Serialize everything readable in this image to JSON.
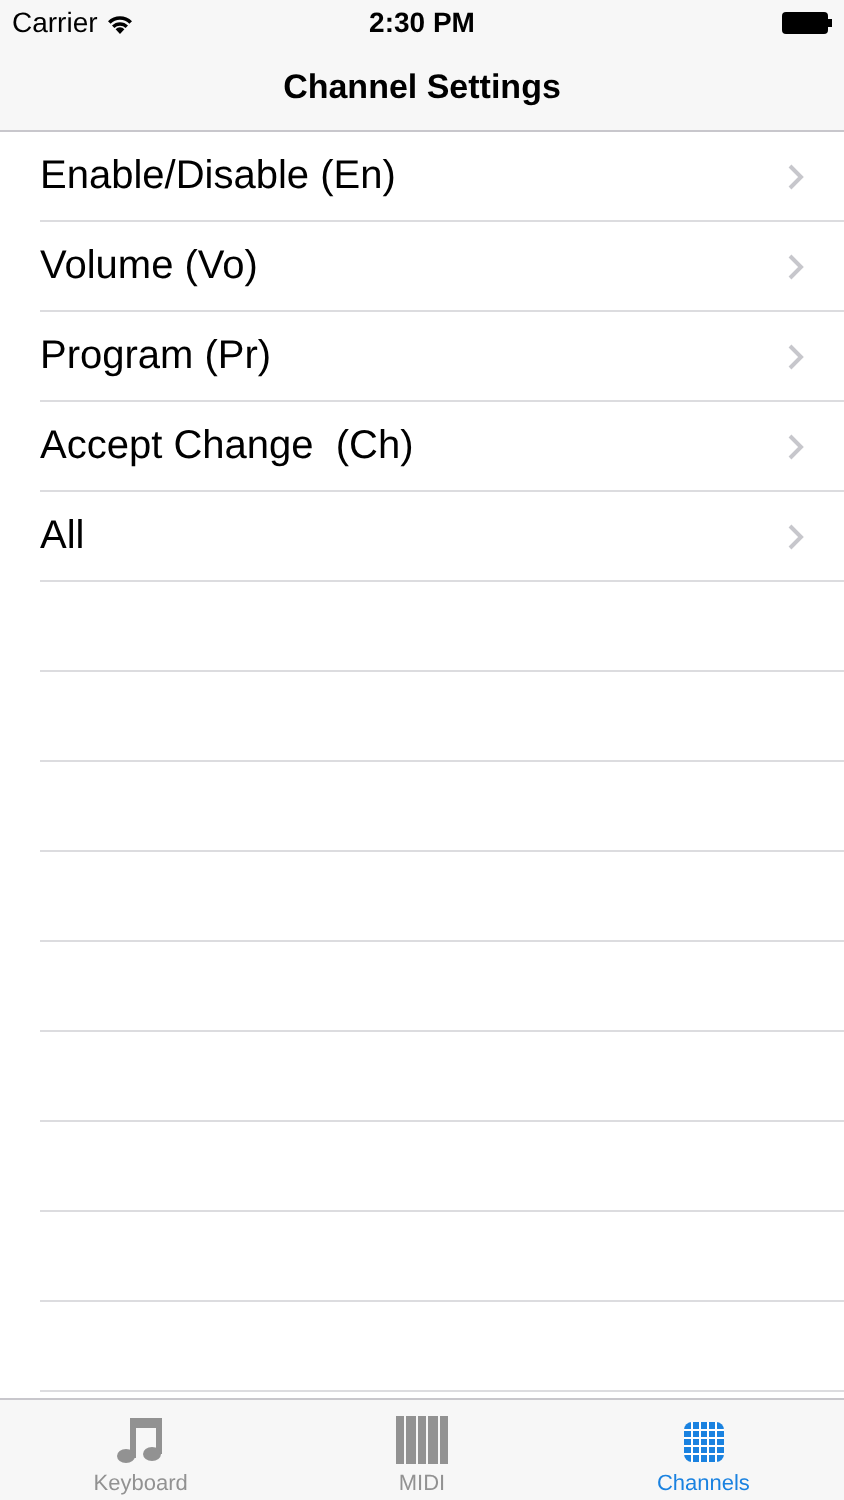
{
  "status_bar": {
    "carrier": "Carrier",
    "time": "2:30 PM"
  },
  "nav_bar": {
    "title": "Channel Settings"
  },
  "settings": [
    {
      "label": "Enable/Disable (En)"
    },
    {
      "label": "Volume (Vo)"
    },
    {
      "label": "Program (Pr)"
    },
    {
      "label": "Accept Change  (Ch)"
    },
    {
      "label": "All"
    }
  ],
  "tab_bar": [
    {
      "label": "Keyboard",
      "kind": "note",
      "selected": false
    },
    {
      "label": "MIDI",
      "kind": "keys",
      "selected": false
    },
    {
      "label": "Channels",
      "kind": "grid",
      "selected": true
    }
  ]
}
